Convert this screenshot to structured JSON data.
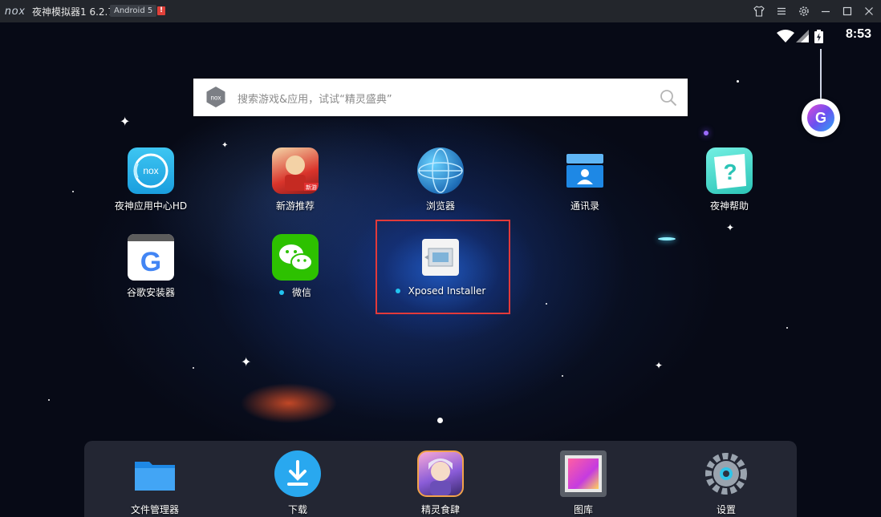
{
  "titlebar": {
    "logo": "nox",
    "title": "夜神模拟器1 6.2.7.0",
    "android_badge": "Android 5",
    "alert_badge": "!"
  },
  "status": {
    "time": "8:53"
  },
  "search": {
    "placeholder": "搜索游戏&应用，试试“精灵盛典”"
  },
  "apps": [
    {
      "label": "夜神应用中心HD",
      "icon": "nox-app-center-icon"
    },
    {
      "label": "新游推荐",
      "icon": "new-games-icon"
    },
    {
      "label": "浏览器",
      "icon": "browser-globe-icon"
    },
    {
      "label": "通讯录",
      "icon": "contacts-icon"
    },
    {
      "label": "夜神帮助",
      "icon": "help-icon"
    },
    {
      "label": "谷歌安装器",
      "icon": "google-installer-icon"
    },
    {
      "label": "微信",
      "icon": "wechat-icon"
    },
    {
      "label": "Xposed Installer",
      "icon": "xposed-installer-icon"
    }
  ],
  "dock": [
    {
      "label": "文件管理器",
      "icon": "folder-icon"
    },
    {
      "label": "下载",
      "icon": "download-icon"
    },
    {
      "label": "精灵食肆",
      "icon": "game-character-icon"
    },
    {
      "label": "图库",
      "icon": "gallery-icon"
    },
    {
      "label": "设置",
      "icon": "settings-gear-icon"
    }
  ],
  "colors": {
    "highlight_border": "#e23a3a",
    "notification_dot": "#22c4f0",
    "titlebar_bg": "#23262c"
  }
}
